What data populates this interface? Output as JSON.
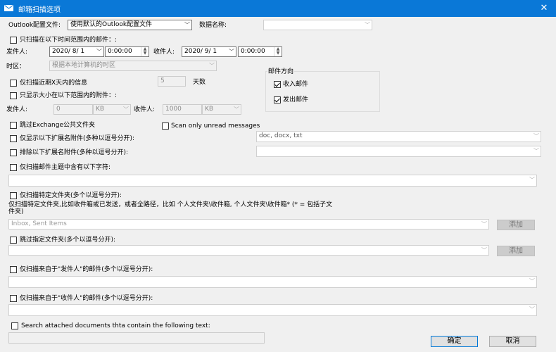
{
  "window": {
    "title": "邮箱扫描选项",
    "close": "✕"
  },
  "outlook_profile": {
    "label": "Outlook配置文件:",
    "value": "使用默认的Outlook配置文件"
  },
  "database": {
    "label": "数据名称:",
    "value": ""
  },
  "date_range": {
    "checkbox_label": "只扫描在以下时间范围内的邮件：:",
    "sender_label": "发件人:",
    "sender_date": "2020/ 8/ 1",
    "sender_time": "0:00:00",
    "recipient_label": "收件人:",
    "recipient_date": "2020/ 9/ 1",
    "recipient_time": "0:00:00"
  },
  "timezone": {
    "label": "时区：",
    "value": "根据本地计算机的时区"
  },
  "recent_days": {
    "label": "仅扫描近期X天内的信息",
    "value": "5",
    "unit": "天数"
  },
  "direction": {
    "title": "邮件方向",
    "inbox": "收入邮件",
    "outbox": "发出邮件"
  },
  "size_range": {
    "checkbox_label": "只显示大小在以下范围内的附件：:",
    "sender_label": "发件人:",
    "from_value": "0",
    "from_unit": "KB",
    "recipient_label": "收件人:",
    "to_value": "1000",
    "to_unit": "KB"
  },
  "skip_exchange": "跳过Exchange公共文件夹",
  "scan_unread": "Scan only unread messages",
  "only_ext": {
    "label": "仅显示以下扩展名附件(多种以逗号分开):",
    "value": "doc, docx, txt"
  },
  "exclude_ext": {
    "label": "排除以下扩展名附件(多种以逗号分开):",
    "value": ""
  },
  "subject": {
    "label": "仅扫描邮件主题中含有以下字符:",
    "value": ""
  },
  "folders": {
    "label": "仅扫描特定文件夹(多个以逗号分开):",
    "desc1": "仅扫描特定文件夹,比如收件箱或已发送，或者全路径，比如    个人文件夹\\收件箱, 个人文件夹\\收件箱* (* = 包括子文",
    "desc2": "件夹)",
    "value": "Inbox, Sent Items",
    "add": "添加"
  },
  "skip_folders": {
    "label": "跳过指定文件夹(多个以逗号分开):",
    "value": "",
    "add": "添加"
  },
  "from_sender": {
    "label": "仅扫描来自于\"发件人\"的邮件(多个以逗号分开):",
    "value": ""
  },
  "from_recipient": {
    "label": "仅扫描来自于\"收件人\"的邮件(多个以逗号分开):",
    "value": ""
  },
  "search_attached": {
    "label": "Search attached documents thta contain the following text:",
    "value": ""
  },
  "buttons": {
    "ok": "确定",
    "cancel": "取消"
  },
  "colors": {
    "titlebar": "#0a78d7",
    "background": "#f0f0f0"
  }
}
